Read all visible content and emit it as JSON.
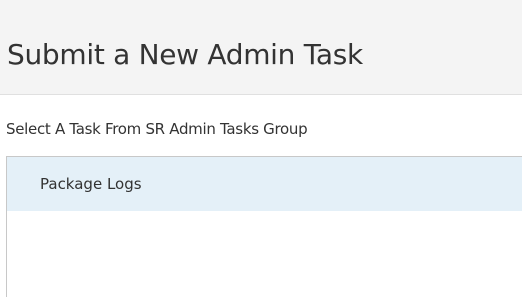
{
  "header": {
    "title": "Submit a New Admin Task"
  },
  "task_select": {
    "label": "Select A Task From SR Admin Tasks Group",
    "items": [
      {
        "label": "Package Logs",
        "selected": true
      }
    ]
  },
  "colors": {
    "header_background": "#f4f4f4",
    "selected_item_background": "#e4f0f8",
    "text": "#333333",
    "list_border": "#c8c8c8"
  }
}
